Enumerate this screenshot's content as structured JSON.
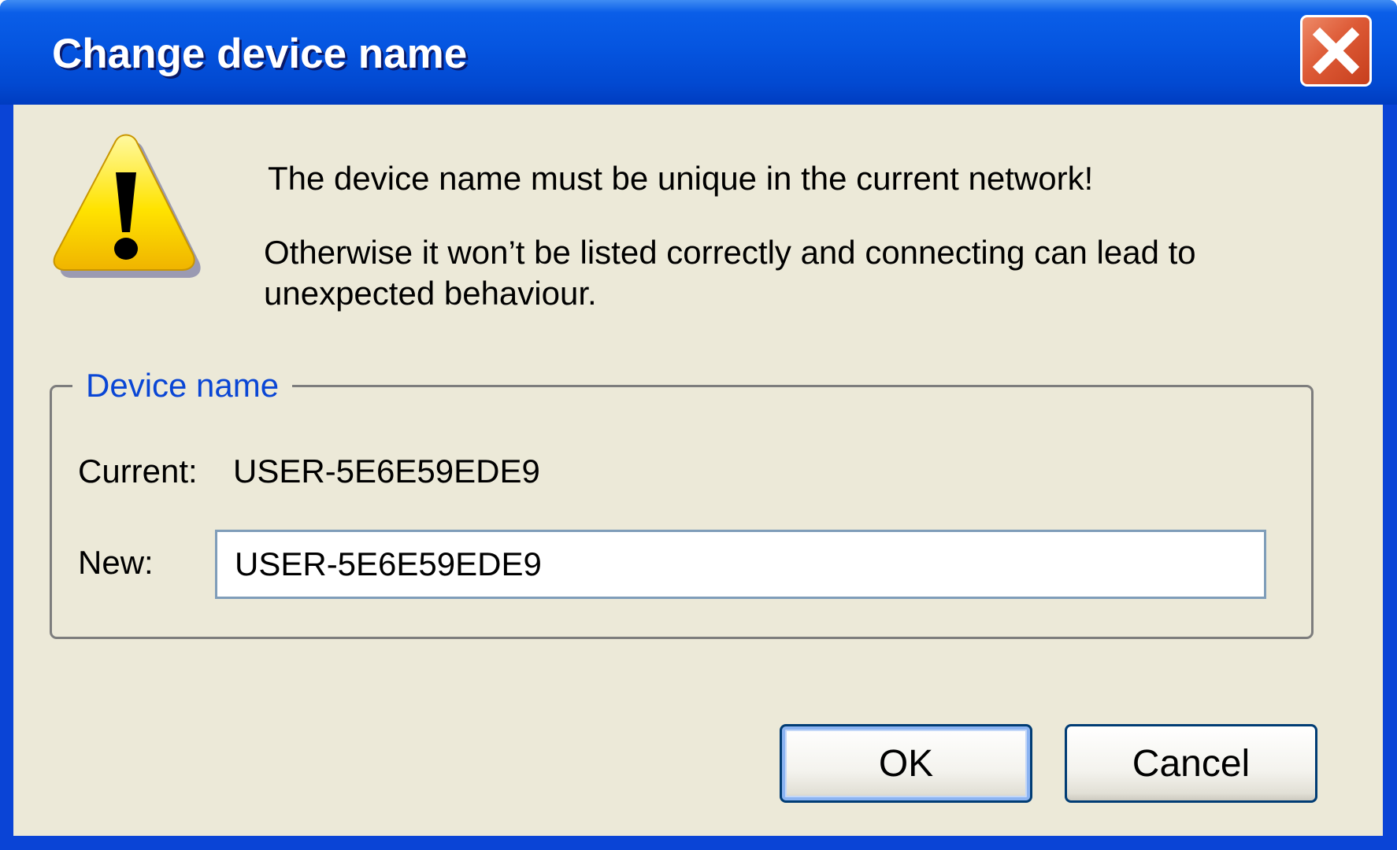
{
  "window": {
    "title": "Change device name",
    "close_icon": "close-x-icon"
  },
  "message": {
    "icon": "warning-triangle-icon",
    "line1": "The device name must be unique in the current network!",
    "line2": "Otherwise it won’t be listed correctly and connecting can lead to unexpected behaviour."
  },
  "device_group": {
    "legend": "Device name",
    "current_label": "Current:",
    "current_value": "USER-5E6E59EDE9",
    "new_label": "New:",
    "new_value": "USER-5E6E59EDE9"
  },
  "buttons": {
    "ok": "OK",
    "cancel": "Cancel"
  },
  "colors": {
    "titlebar": "#0555e0",
    "client_background": "#ece9d8",
    "legend_text": "#0a46d5",
    "close_button": "#dd5a36",
    "input_border": "#7f9db9"
  }
}
